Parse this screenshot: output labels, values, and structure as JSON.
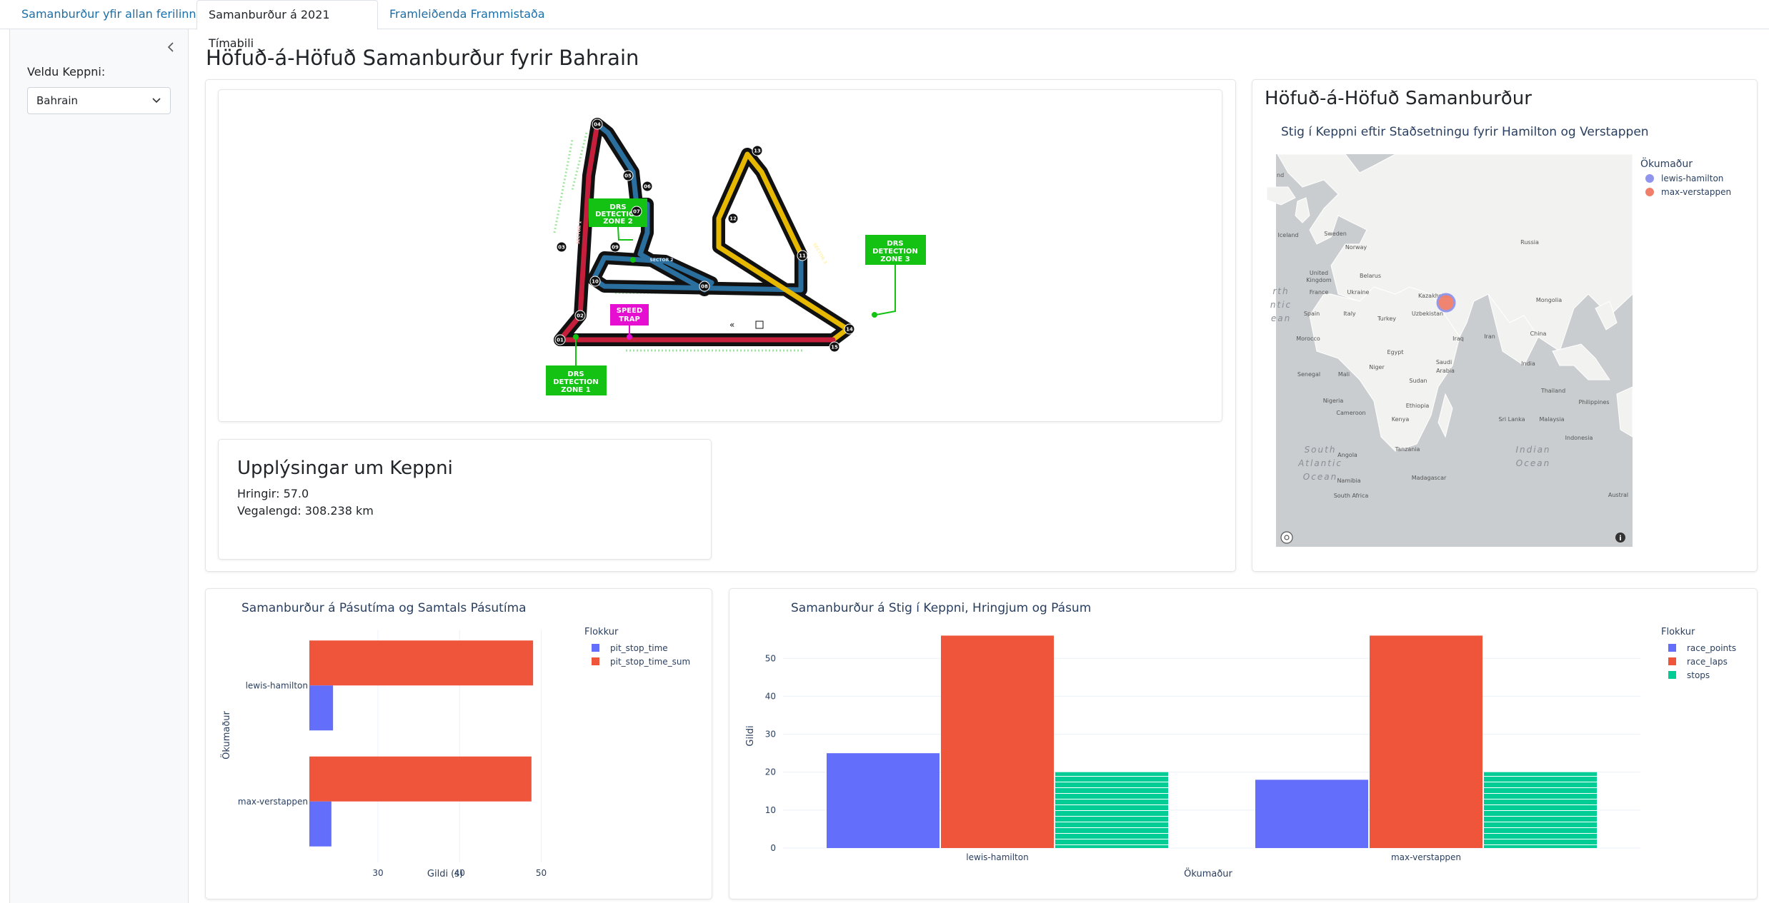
{
  "tabs": [
    {
      "label": "Samanburður yfir allan ferilinn"
    },
    {
      "label": "Samanburður á 2021 Tímabili"
    },
    {
      "label": "Framleiðenda Frammistaða"
    }
  ],
  "sidebar": {
    "collapse_icon": "chevron-left-icon",
    "select_label": "Veldu Keppni:",
    "select_value": "Bahrain"
  },
  "page_title": "Höfuð-á-Höfuð Samanburður fyrir Bahrain",
  "circuit": {
    "labels": {
      "drs_zone_1": "DRS DETECTION ZONE 1",
      "drs_zone_2": "DRS DETECTION ZONE 2",
      "drs_zone_3": "DRS DETECTION ZONE 3",
      "speed_trap": "SPEED TRAP",
      "sector_1": "SECTOR 1",
      "sector_2": "SECTOR 2",
      "sector_3": "SECTOR 3"
    },
    "turns": [
      "01",
      "02",
      "03",
      "04",
      "05",
      "06",
      "07",
      "08",
      "09",
      "10",
      "11",
      "12",
      "13",
      "14",
      "15"
    ]
  },
  "race_info": {
    "title": "Upplýsingar um Keppni",
    "laps": "Hringir: 57.0",
    "distance": "Vegalengd: 308.238 km"
  },
  "map_panel": {
    "heading": "Höfuð-á-Höfuð Samanburður",
    "title": "Stig í Keppni eftir Staðsetningu fyrir Hamilton og Verstappen",
    "legend_title": "Ökumaður",
    "legend": [
      {
        "name": "lewis-hamilton",
        "color": "#8f94ec"
      },
      {
        "name": "max-verstappen",
        "color": "#ef7f6a"
      }
    ],
    "place_labels": [
      "Iceland",
      "Sweden",
      "Norway",
      "Russia",
      "United Kingdom",
      "Belarus",
      "Ukraine",
      "France",
      "Kazakhstan",
      "Mongolia",
      "Spain",
      "Italy",
      "Uzbekistan",
      "Turkey",
      "Morocco",
      "Iraq",
      "Iran",
      "China",
      "Egypt",
      "Saudi Arabia",
      "India",
      "Senegal",
      "Mali",
      "Niger",
      "Sudan",
      "Nigeria",
      "Ethiopia",
      "Thailand",
      "Cameroon",
      "Kenya",
      "Sri Lanka",
      "Malaysia",
      "Tanzania",
      "Indonesia",
      "Angola",
      "Philippines",
      "Namibia",
      "Madagascar",
      "South Africa",
      "Austral"
    ],
    "ocean_labels": [
      [
        "South",
        "Atlantic",
        "Ocean"
      ],
      [
        "Indian",
        "Ocean"
      ],
      [
        "rth",
        "ntic",
        "ean"
      ]
    ],
    "edge_label": "nd",
    "icons": {
      "left": "mapbox-logo-icon",
      "right": "info-icon"
    }
  },
  "pit_chart": {
    "title": "Samanburður á Pásutíma og Samtals Pásutíma",
    "legend_title": "Flokkur",
    "colors": {
      "pit_stop_time": "#636efa",
      "pit_stop_time_sum": "#ef553b"
    },
    "chart_data": {
      "type": "bar",
      "orientation": "horizontal",
      "categories": [
        "lewis-hamilton",
        "max-verstappen"
      ],
      "series": [
        {
          "name": "pit_stop_time",
          "values": [
            24.5,
            24.3
          ]
        },
        {
          "name": "pit_stop_time_sum",
          "values": [
            49.0,
            48.8
          ]
        }
      ],
      "xlabel": "Gildi (s)",
      "ylabel": "Ökumaður",
      "xlim": [
        21.6,
        51
      ],
      "xticks": [
        30,
        40,
        50
      ]
    }
  },
  "points_chart": {
    "title": "Samanburður á Stig í Keppni, Hringjum og Pásum",
    "legend_title": "Flokkur",
    "colors": {
      "race_points": "#636efa",
      "race_laps": "#ef553b",
      "stops": "#00cc96"
    },
    "chart_data": {
      "type": "bar",
      "categories": [
        "lewis-hamilton",
        "max-verstappen"
      ],
      "series": [
        {
          "name": "race_points",
          "values": [
            25,
            18
          ]
        },
        {
          "name": "race_laps",
          "values": [
            56,
            56
          ]
        },
        {
          "name": "stops",
          "values": [
            20,
            20
          ]
        }
      ],
      "xlabel": "Ökumaður",
      "ylabel": "Gildi",
      "ylim": [
        0,
        58.9
      ],
      "yticks": [
        0,
        10,
        20,
        30,
        40,
        50
      ]
    }
  }
}
